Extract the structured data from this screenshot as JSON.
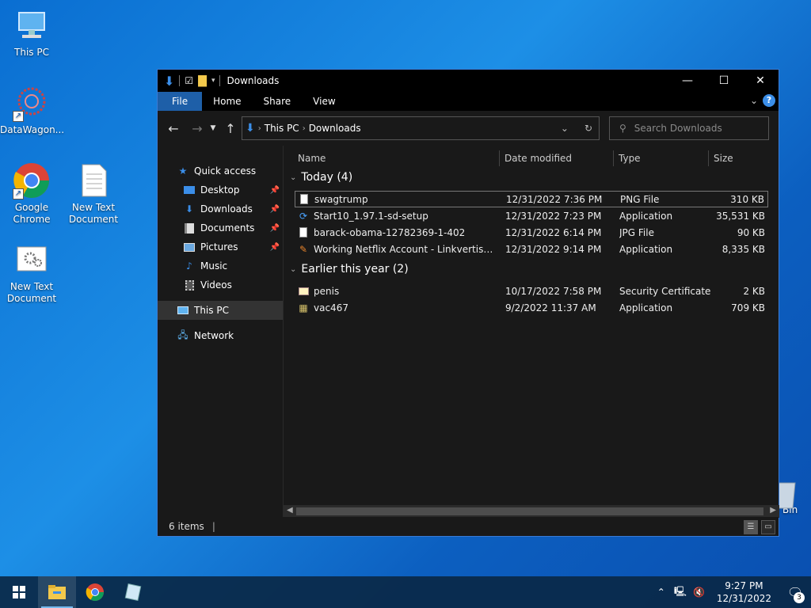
{
  "desktop": {
    "icons": [
      {
        "label": "This PC"
      },
      {
        "label": "DataWagon..."
      },
      {
        "label": "Google Chrome"
      },
      {
        "label": "New Text Document"
      },
      {
        "label": "New Text Document"
      },
      {
        "label": "e Bin"
      }
    ]
  },
  "window": {
    "title": "Downloads",
    "controls": {
      "minimize": "—",
      "maximize": "☐",
      "close": "✕"
    },
    "ribbon_tabs": [
      "File",
      "Home",
      "Share",
      "View"
    ],
    "address": {
      "crumbs": [
        "This PC",
        "Downloads"
      ]
    },
    "search": {
      "placeholder": "Search Downloads"
    },
    "nav_pane": {
      "quick_access": "Quick access",
      "items": [
        {
          "label": "Desktop",
          "pinned": true
        },
        {
          "label": "Downloads",
          "pinned": true
        },
        {
          "label": "Documents",
          "pinned": true
        },
        {
          "label": "Pictures",
          "pinned": true
        },
        {
          "label": "Music",
          "pinned": false
        },
        {
          "label": "Videos",
          "pinned": false
        }
      ],
      "this_pc": "This PC",
      "network": "Network"
    },
    "columns": {
      "name": "Name",
      "date": "Date modified",
      "type": "Type",
      "size": "Size"
    },
    "groups": [
      {
        "title": "Today (4)",
        "files": [
          {
            "name": "swagtrump",
            "date": "12/31/2022 7:36 PM",
            "type": "PNG File",
            "size": "310 KB",
            "icon": "image-file-icon"
          },
          {
            "name": "Start10_1.97.1-sd-setup",
            "date": "12/31/2022 7:23 PM",
            "type": "Application",
            "size": "35,531 KB",
            "icon": "installer-icon"
          },
          {
            "name": "barack-obama-12782369-1-402",
            "date": "12/31/2022 6:14 PM",
            "type": "JPG File",
            "size": "90 KB",
            "icon": "image-file-icon"
          },
          {
            "name": "Working Netflix Account - Linkvertise Do...",
            "date": "12/31/2022 9:14 PM",
            "type": "Application",
            "size": "8,335 KB",
            "icon": "app-icon"
          }
        ]
      },
      {
        "title": "Earlier this year (2)",
        "files": [
          {
            "name": "penis",
            "date": "10/17/2022 7:58 PM",
            "type": "Security Certificate",
            "size": "2 KB",
            "icon": "certificate-icon"
          },
          {
            "name": "vac467",
            "date": "9/2/2022 11:37 AM",
            "type": "Application",
            "size": "709 KB",
            "icon": "app-icon"
          }
        ]
      }
    ],
    "status": {
      "items": "6 items"
    }
  },
  "taskbar": {
    "time": "9:27 PM",
    "date": "12/31/2022",
    "notifications": "3"
  },
  "colors": {
    "accent": "#1e5fa8",
    "window_bg": "#191919",
    "desktop_blue": "#0a6ed1"
  }
}
